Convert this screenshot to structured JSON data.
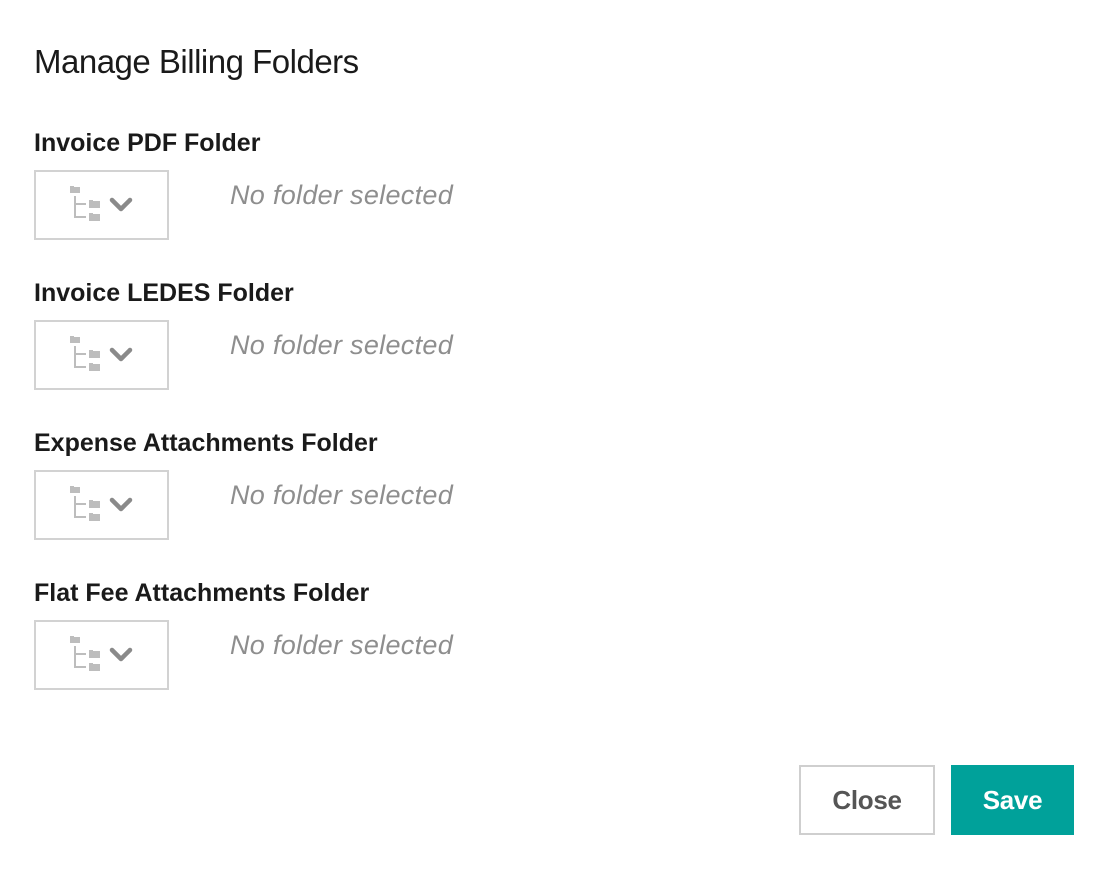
{
  "dialog": {
    "title": "Manage Billing Folders"
  },
  "folders": [
    {
      "label": "Invoice PDF Folder",
      "status": "No folder selected",
      "icon": "folder-tree-icon"
    },
    {
      "label": "Invoice LEDES Folder",
      "status": "No folder selected",
      "icon": "folder-tree-icon"
    },
    {
      "label": "Expense Attachments Folder",
      "status": "No folder selected",
      "icon": "folder-tree-icon"
    },
    {
      "label": "Flat Fee Attachments Folder",
      "status": "No folder selected",
      "icon": "folder-tree-icon"
    }
  ],
  "footer": {
    "close_label": "Close",
    "save_label": "Save"
  },
  "colors": {
    "accent": "#00a19a",
    "accent_text": "#ffffff",
    "muted_text": "#8e8e8e",
    "icon": "#b5b5b5"
  }
}
